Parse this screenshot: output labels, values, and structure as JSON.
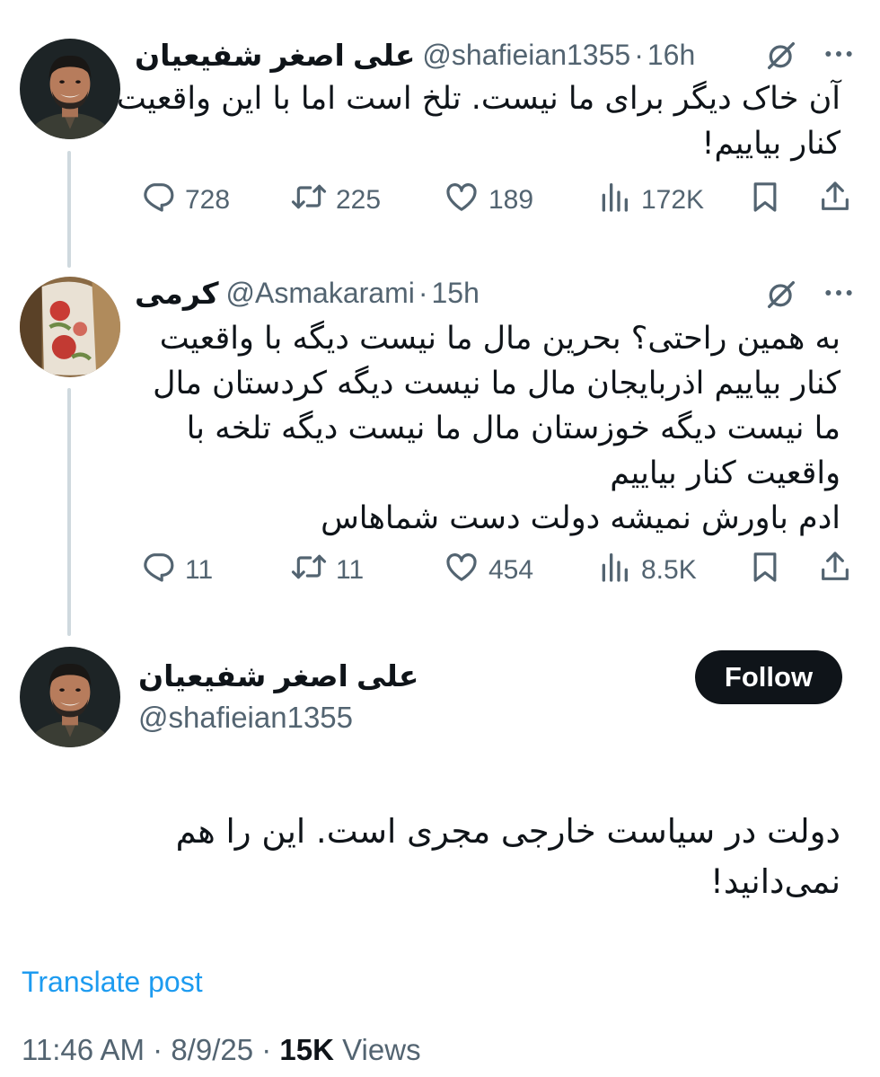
{
  "tweets": [
    {
      "name": "علی اصغر شفیعیان",
      "handle": "@shafieian1355",
      "separator": "·",
      "time": "16h",
      "text": "آن خاک دیگر برای ما نیست. تلخ است اما با این واقعیت\nکنار بیاییم!",
      "stats": {
        "replies": "728",
        "reposts": "225",
        "likes": "189",
        "views": "172K"
      }
    },
    {
      "name": "کرمی",
      "handle": "@Asmakarami",
      "separator": "·",
      "time": "15h",
      "text": "به همین راحتی؟ بحرین مال ما نیست دیگه با واقعیت\nکنار بیاییم اذربایجان مال ما نیست دیگه کردستان مال\nما نیست دیگه خوزستان مال ما نیست دیگه تلخه با\nواقعیت کنار بیاییم\nادم باورش نمیشه دولت دست شماهاس",
      "stats": {
        "replies": "11",
        "reposts": "11",
        "likes": "454",
        "views": "8.5K"
      }
    }
  ],
  "main_post": {
    "name": "علی اصغر شفیعیان",
    "handle": "@shafieian1355",
    "follow_label": "Follow",
    "text": "دولت در سیاست خارجی مجری است. این را هم\nنمی‌دانید!",
    "translate_label": "Translate post",
    "time": "11:46 AM",
    "date": "8/9/25",
    "separator": "·",
    "views_count": "15K",
    "views_label": "Views"
  },
  "icons": [
    "reply-icon",
    "repost-icon",
    "like-icon",
    "views-icon",
    "bookmark-icon",
    "share-icon",
    "grok-icon",
    "more-icon"
  ],
  "colors": {
    "text": "#0f1419",
    "muted": "#536471",
    "link": "#1d9bf0",
    "thread_line": "#cfd9de",
    "follow_bg": "#0f1419"
  }
}
